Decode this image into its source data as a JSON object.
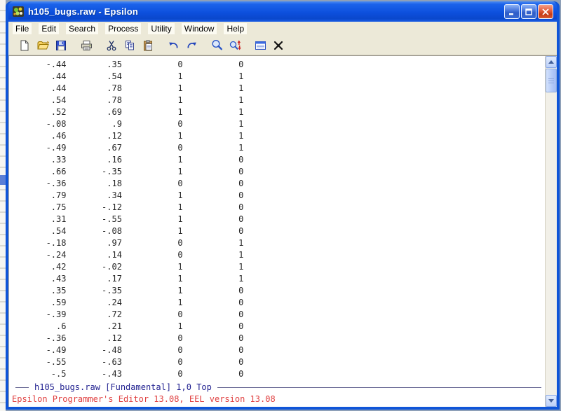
{
  "window": {
    "title": "h105_bugs.raw - Epsilon",
    "icon": "epsilon-bug-icon"
  },
  "titlebar_controls": [
    "minimize",
    "maximize",
    "close"
  ],
  "menu": {
    "items": [
      "File",
      "Edit",
      "Search",
      "Process",
      "Utility",
      "Window",
      "Help"
    ]
  },
  "toolbar": {
    "icons": [
      "new-file",
      "open-file",
      "save-file",
      "print",
      "cut",
      "copy",
      "paste",
      "undo",
      "redo",
      "find",
      "find-replace",
      "buffer-list",
      "close-window"
    ]
  },
  "editor": {
    "rows": [
      [
        "-.44",
        ".35",
        "0",
        "0"
      ],
      [
        ".44",
        ".54",
        "1",
        "1"
      ],
      [
        ".44",
        ".78",
        "1",
        "1"
      ],
      [
        ".54",
        ".78",
        "1",
        "1"
      ],
      [
        ".52",
        ".69",
        "1",
        "1"
      ],
      [
        "-.08",
        ".9",
        "0",
        "1"
      ],
      [
        ".46",
        ".12",
        "1",
        "1"
      ],
      [
        "-.49",
        ".67",
        "0",
        "1"
      ],
      [
        ".33",
        ".16",
        "1",
        "0"
      ],
      [
        ".66",
        "-.35",
        "1",
        "0"
      ],
      [
        "-.36",
        ".18",
        "0",
        "0"
      ],
      [
        ".79",
        ".34",
        "1",
        "0"
      ],
      [
        ".75",
        "-.12",
        "1",
        "0"
      ],
      [
        ".31",
        "-.55",
        "1",
        "0"
      ],
      [
        ".54",
        "-.08",
        "1",
        "0"
      ],
      [
        "-.18",
        ".97",
        "0",
        "1"
      ],
      [
        "-.24",
        ".14",
        "0",
        "1"
      ],
      [
        ".42",
        "-.02",
        "1",
        "1"
      ],
      [
        ".43",
        ".17",
        "1",
        "1"
      ],
      [
        ".35",
        "-.35",
        "1",
        "0"
      ],
      [
        ".59",
        ".24",
        "1",
        "0"
      ],
      [
        "-.39",
        ".72",
        "0",
        "0"
      ],
      [
        ".6",
        ".21",
        "1",
        "0"
      ],
      [
        "-.36",
        ".12",
        "0",
        "0"
      ],
      [
        "-.49",
        "-.48",
        "0",
        "0"
      ],
      [
        "-.55",
        "-.63",
        "0",
        "0"
      ],
      [
        "-.5",
        "-.43",
        "0",
        "0"
      ]
    ]
  },
  "statusbar": {
    "modeline": "h105_bugs.raw [Fundamental] 1,0 Top"
  },
  "message_line": {
    "text": "Epsilon Programmer's Editor 13.08, EEL version 13.08"
  },
  "colors": {
    "titlebar_blue": "#0f55d8",
    "chrome_bg": "#ece9d8",
    "modeline_text": "#1f1f8f",
    "message_text": "#e04040",
    "editor_text": "#262626"
  }
}
